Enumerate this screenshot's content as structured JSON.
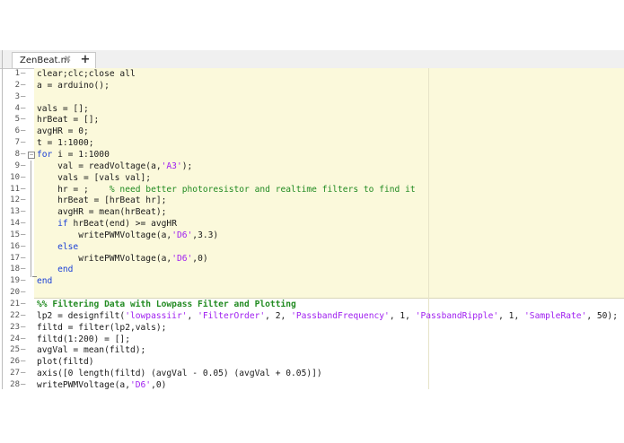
{
  "tabs": [
    {
      "label": "ZenBeat.m",
      "close_icon": "✖",
      "pin_icon": "✕"
    }
  ],
  "add_tab_label": "+",
  "lines": [
    {
      "num": "1",
      "code": "clear;clc;close all"
    },
    {
      "num": "2",
      "code": "a = arduino();"
    },
    {
      "num": "3",
      "code": ""
    },
    {
      "num": "4",
      "code": "vals = [];"
    },
    {
      "num": "5",
      "code": "hrBeat = [];"
    },
    {
      "num": "6",
      "code": "avgHR = 0;"
    },
    {
      "num": "7",
      "code": "t = 1:1000;"
    },
    {
      "num": "8",
      "code": "for i = 1:1000"
    },
    {
      "num": "9",
      "code": "    val = readVoltage(a,'A3');"
    },
    {
      "num": "10",
      "code": "    vals = [vals val];"
    },
    {
      "num": "11",
      "code": "    hr = ;    % need better photoresistor and realtime filters to find it"
    },
    {
      "num": "12",
      "code": "    hrBeat = [hrBeat hr];"
    },
    {
      "num": "13",
      "code": "    avgHR = mean(hrBeat);"
    },
    {
      "num": "14",
      "code": "    if hrBeat(end) >= avgHR"
    },
    {
      "num": "15",
      "code": "        writePWMVoltage(a,'D6',3.3)"
    },
    {
      "num": "16",
      "code": "    else"
    },
    {
      "num": "17",
      "code": "        writePWMVoltage(a,'D6',0)"
    },
    {
      "num": "18",
      "code": "    end"
    },
    {
      "num": "19",
      "code": "end"
    },
    {
      "num": "20",
      "code": ""
    },
    {
      "num": "21",
      "code": "%% Filtering Data with Lowpass Filter and Plotting"
    },
    {
      "num": "22",
      "code": "lp2 = designfilt('lowpassiir', 'FilterOrder', 2, 'PassbandFrequency', 1, 'PassbandRipple', 1, 'SampleRate', 50);"
    },
    {
      "num": "23",
      "code": "filtd = filter(lp2,vals);"
    },
    {
      "num": "24",
      "code": "filtd(1:200) = [];"
    },
    {
      "num": "25",
      "code": "avgVal = mean(filtd);"
    },
    {
      "num": "26",
      "code": "plot(filtd)"
    },
    {
      "num": "27",
      "code": "axis([0 length(filtd) (avgVal - 0.05) (avgVal + 0.05)])"
    },
    {
      "num": "28",
      "code": "writePWMVoltage(a,'D6',0)"
    }
  ],
  "colors": {
    "keyword": "#1a3fd6",
    "string": "#a020f0",
    "comment": "#228b22",
    "cell_highlight": "#fbf9db"
  }
}
